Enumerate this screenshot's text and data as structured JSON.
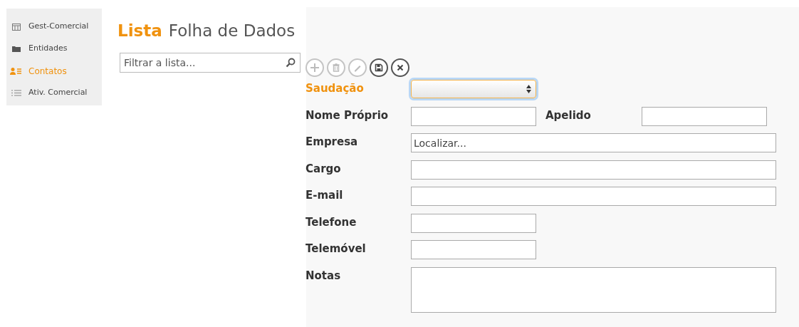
{
  "sidebar": {
    "items": [
      {
        "label": "Gest-Comercial",
        "kind": "calendar",
        "selected": false
      },
      {
        "label": "Entidades",
        "kind": "folder",
        "selected": false
      },
      {
        "label": "Contatos",
        "kind": "contacts",
        "selected": true
      },
      {
        "label": "Ativ. Comercial",
        "kind": "list",
        "selected": false
      }
    ]
  },
  "header": {
    "title": "Lista",
    "subtitle": "Folha de Dados"
  },
  "filter": {
    "placeholder": "Filtrar a lista..."
  },
  "toolbar": [
    {
      "kind": "add",
      "disabled": true
    },
    {
      "kind": "delete",
      "disabled": true
    },
    {
      "kind": "edit",
      "disabled": true
    },
    {
      "kind": "save",
      "disabled": false
    },
    {
      "kind": "cancel",
      "disabled": false
    }
  ],
  "form": {
    "rows": [
      {
        "fields": [
          {
            "label": "Saudação",
            "kind": "select",
            "focused": true
          }
        ]
      },
      {
        "fields": [
          {
            "label": "Nome Próprio",
            "kind": "short",
            "focused": false
          },
          {
            "label": "Apelido",
            "kind": "short",
            "focused": false
          }
        ]
      },
      {
        "fields": [
          {
            "label": "Empresa",
            "kind": "lookup",
            "focused": false,
            "placeholder": "Localizar..."
          }
        ]
      },
      {
        "fields": [
          {
            "label": "Cargo",
            "kind": "long",
            "focused": false
          }
        ]
      },
      {
        "fields": [
          {
            "label": "E-mail",
            "kind": "long",
            "focused": false
          }
        ]
      },
      {
        "fields": [
          {
            "label": "Telefone",
            "kind": "short",
            "focused": false
          }
        ]
      },
      {
        "fields": [
          {
            "label": "Telemóvel",
            "kind": "short",
            "focused": false
          }
        ]
      },
      {
        "fields": [
          {
            "label": "Notas",
            "kind": "textarea",
            "focused": false
          }
        ]
      }
    ]
  }
}
